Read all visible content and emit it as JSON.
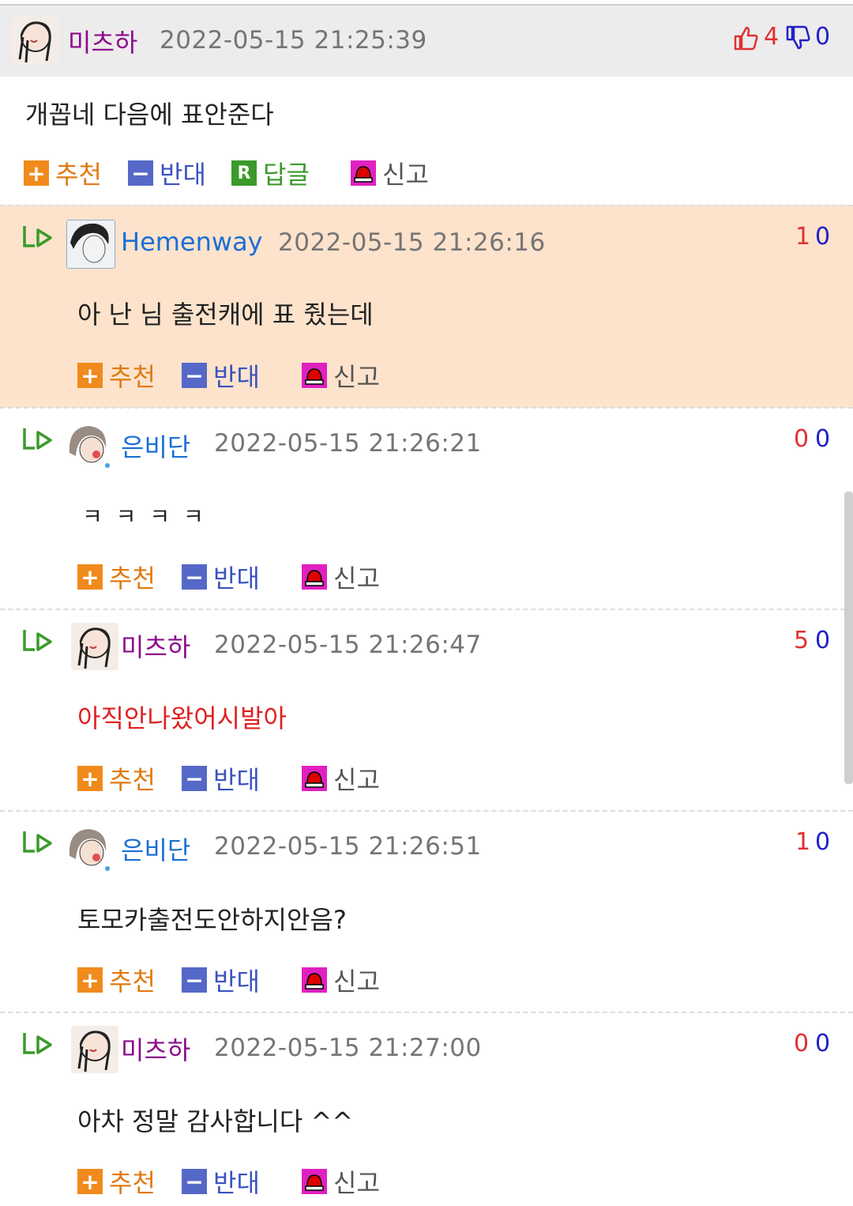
{
  "comments": [
    {
      "nick": "미츠하",
      "date": "2022-05-15 21:25:39",
      "up": "4",
      "down": "0",
      "text": "개꼽네 다음에 표안준다"
    },
    {
      "nick": "Hemenway",
      "date": "2022-05-15 21:26:16",
      "up": "1",
      "down": "0",
      "text": "아 난 님 출전캐에 표 줬는데"
    },
    {
      "nick": "은비단",
      "date": "2022-05-15 21:26:21",
      "up": "0",
      "down": "0",
      "text": "ㅋ ㅋ ㅋ ㅋ"
    },
    {
      "nick": "미츠하",
      "date": "2022-05-15 21:26:47",
      "up": "5",
      "down": "0",
      "text": "아직안나왔어시발아"
    },
    {
      "nick": "은비단",
      "date": "2022-05-15 21:26:51",
      "up": "1",
      "down": "0",
      "text": "토모카출전도안하지안음?"
    },
    {
      "nick": "미츠하",
      "date": "2022-05-15 21:27:00",
      "up": "0",
      "down": "0",
      "text": "아차 정말 감사합니다 ^^"
    }
  ],
  "actions": {
    "recommend": "추천",
    "oppose": "반대",
    "reply": "답글",
    "report": "신고",
    "reply_icon_letter": "R"
  },
  "icons": {
    "thumbs_up": "thumbs-up-icon",
    "thumbs_down": "thumbs-down-icon",
    "reply_arrow": "reply-arrow-icon",
    "siren": "siren-icon"
  },
  "colors": {
    "upvote": "#e03030",
    "downvote": "#2020c8",
    "purple_nick": "#8b0a8b",
    "blue_nick": "#1a6fd6",
    "highlight": "#fde3cc"
  }
}
